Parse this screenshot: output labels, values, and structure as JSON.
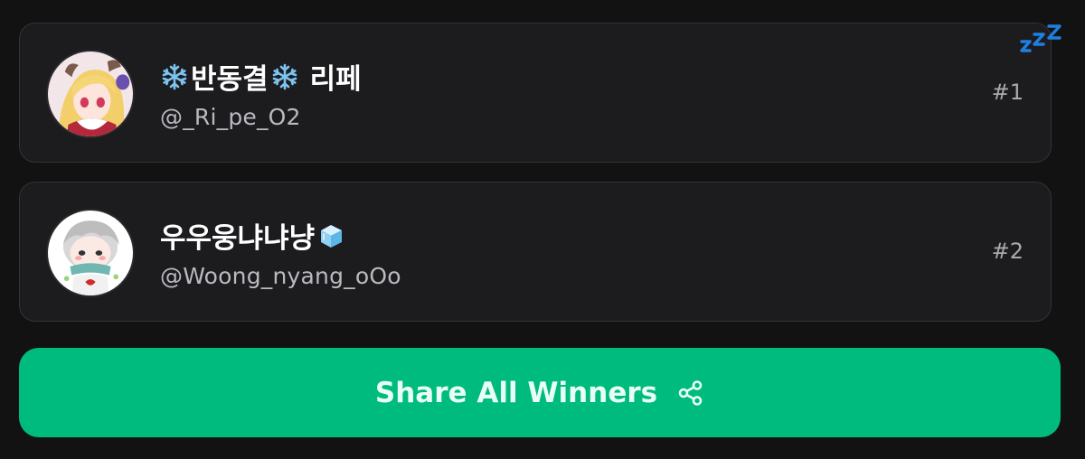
{
  "winners": [
    {
      "name": "반동결",
      "name_suffix": "리페",
      "handle": "@_Ri_pe_O2",
      "rank": "#1",
      "avatar": "anime-girl-blonde-avatar",
      "emoji": "snowflake-icon"
    },
    {
      "name": "우우웅냐냐냥",
      "handle": "@Woong_nyang_oOo",
      "rank": "#2",
      "avatar": "chibi-boy-avatar",
      "emoji": "ice-cube-icon"
    }
  ],
  "share": {
    "label": "Share All Winners",
    "icon": "share-icon"
  },
  "colors": {
    "background": "#121212",
    "card": "#1c1c1f",
    "accent": "#00bb7e",
    "zzz": "#1f7fe0"
  },
  "decor": {
    "sleep_icon": "zzz-icon"
  }
}
